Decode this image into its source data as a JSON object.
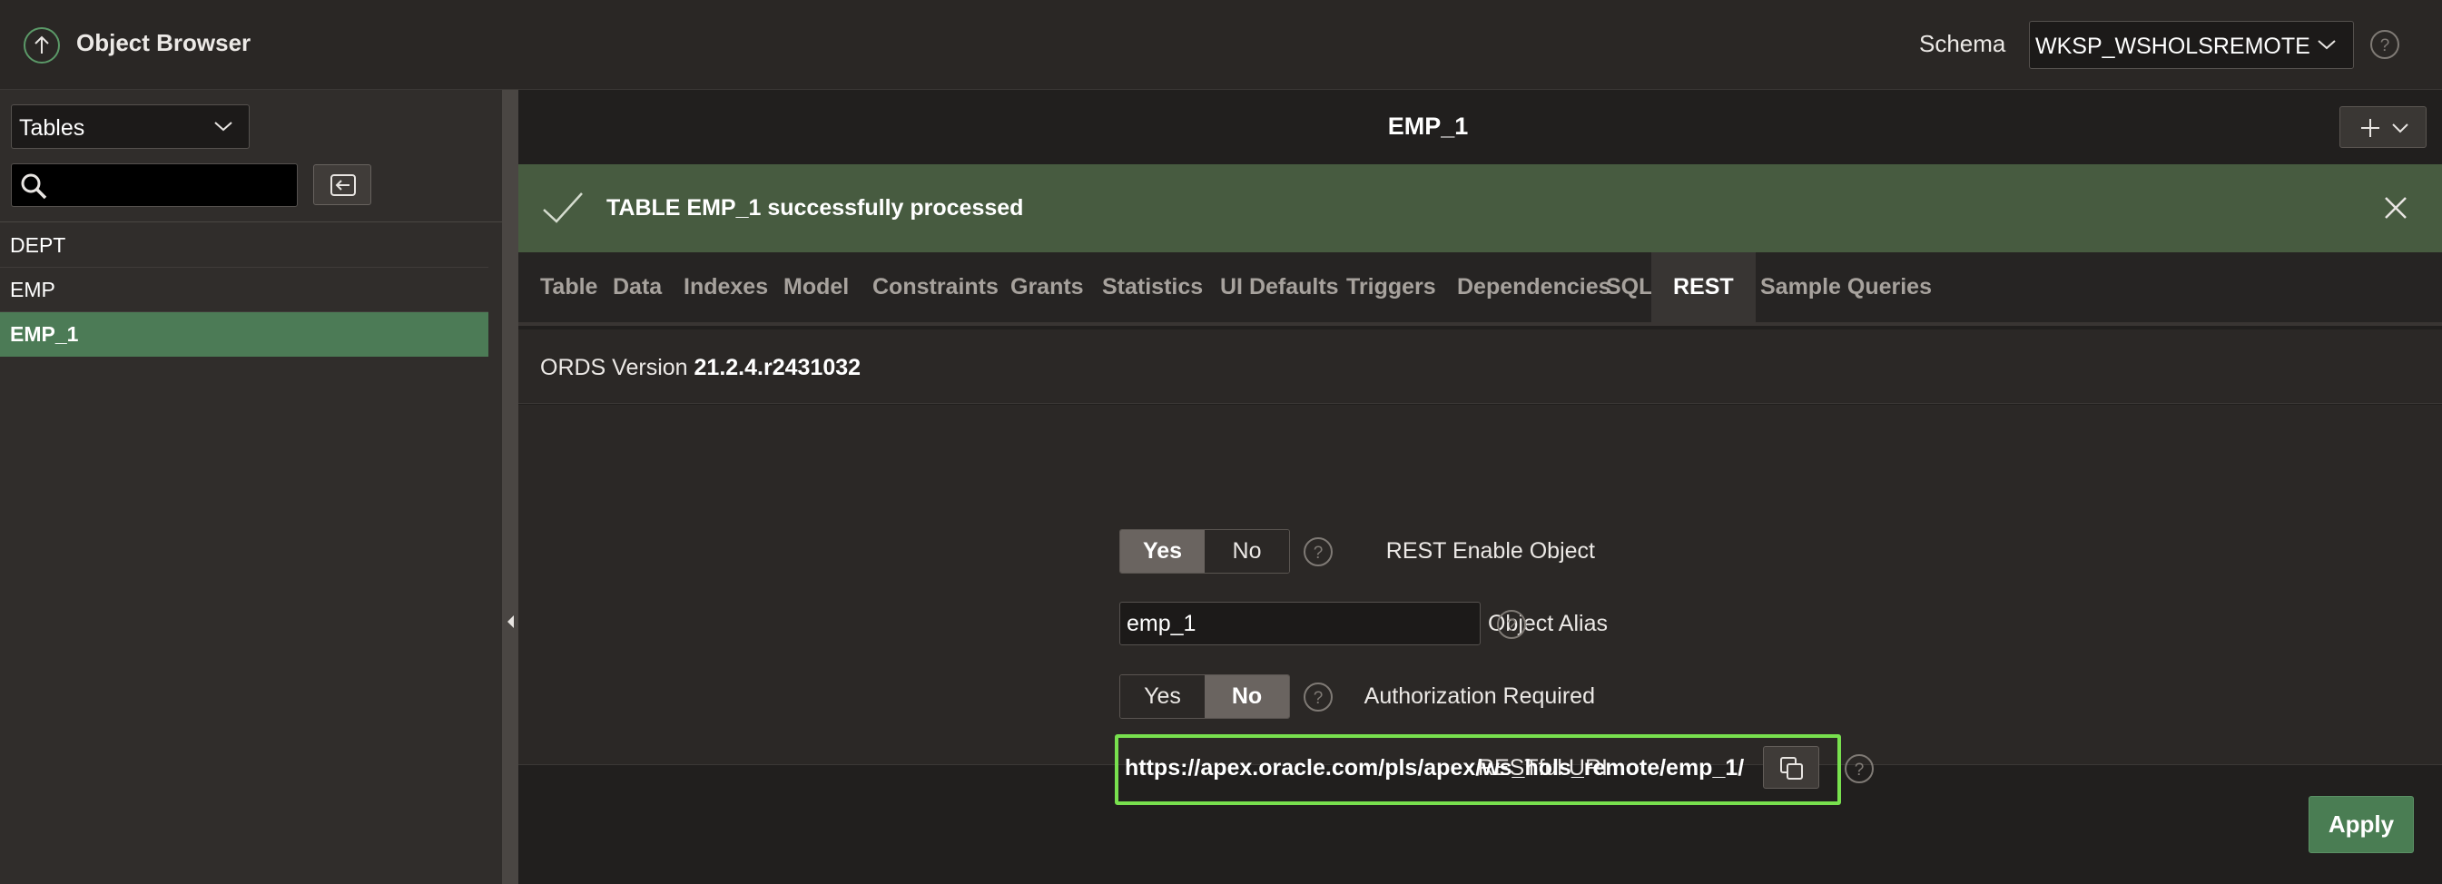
{
  "header": {
    "app_title": "Object Browser",
    "schema_label": "Schema",
    "schema_value": "WKSP_WSHOLSREMOTE"
  },
  "sidebar": {
    "object_type": "Tables",
    "search_value": "",
    "objects": [
      "DEPT",
      "EMP",
      "EMP_1"
    ],
    "selected": "EMP_1"
  },
  "object": {
    "title": "EMP_1"
  },
  "alert": {
    "message": "TABLE EMP_1 successfully processed"
  },
  "tabs": [
    "Table",
    "Data",
    "Indexes",
    "Model",
    "Constraints",
    "Grants",
    "Statistics",
    "UI Defaults",
    "Triggers",
    "Dependencies",
    "SQL",
    "REST",
    "Sample Queries"
  ],
  "active_tab": "REST",
  "rest": {
    "ords_label": "ORDS Version",
    "ords_version": "21.2.4.r2431032",
    "enable_label": "REST Enable Object",
    "enable_yes": "Yes",
    "enable_no": "No",
    "enable_value": "Yes",
    "alias_label": "Object Alias",
    "alias_value": "emp_1",
    "auth_label": "Authorization Required",
    "auth_yes": "Yes",
    "auth_no": "No",
    "auth_value": "No",
    "uri_label": "RESTful URI",
    "uri_value": "https://apex.oracle.com/pls/apex/ws_hols_remote/emp_1/"
  },
  "actions": {
    "apply_label": "Apply"
  },
  "colors": {
    "accent_green": "#4c7b56",
    "alert_bg": "#475b40",
    "highlight_border": "#78e04e"
  }
}
